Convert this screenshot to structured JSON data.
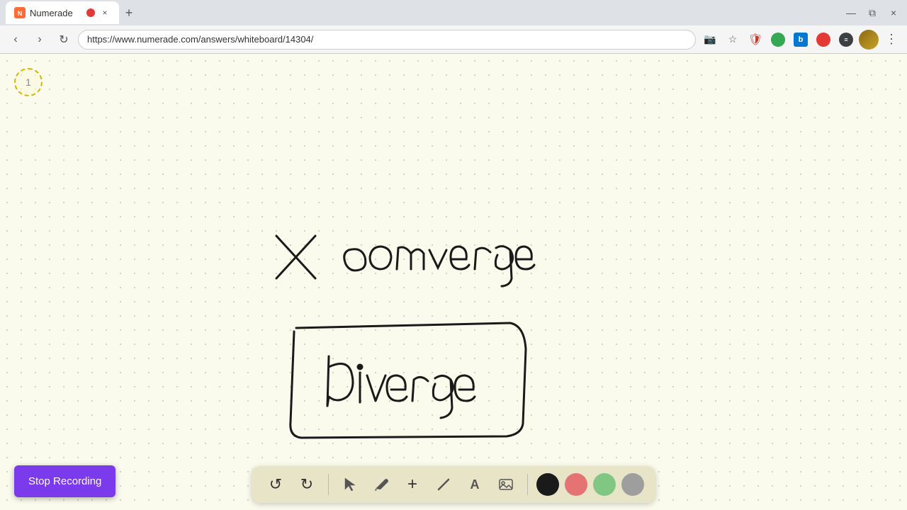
{
  "browser": {
    "tab": {
      "favicon_label": "N",
      "title": "Numerade",
      "recording_dot": true,
      "close_label": "×"
    },
    "new_tab_label": "+",
    "window_controls": {
      "minimize": "—",
      "maximize": "⧉",
      "close": "×"
    },
    "address_bar": {
      "url": "https://www.numerade.com/answers/whiteboard/14304/",
      "back_label": "‹",
      "forward_label": "›",
      "reload_label": "↻"
    }
  },
  "whiteboard": {
    "page_number": "1",
    "drawing": {
      "line1_text": "× converge",
      "line2_text": "diverge"
    }
  },
  "toolbar": {
    "tools": [
      {
        "name": "undo",
        "label": "↺"
      },
      {
        "name": "redo",
        "label": "↻"
      },
      {
        "name": "select",
        "label": "▲"
      },
      {
        "name": "pen",
        "label": "✏"
      },
      {
        "name": "add",
        "label": "+"
      },
      {
        "name": "eraser",
        "label": "╱"
      },
      {
        "name": "text",
        "label": "A"
      },
      {
        "name": "image",
        "label": "🖼"
      }
    ],
    "colors": [
      {
        "name": "black",
        "hex": "#1a1a1a"
      },
      {
        "name": "pink",
        "hex": "#e57373"
      },
      {
        "name": "green",
        "hex": "#81c784"
      },
      {
        "name": "gray",
        "hex": "#9e9e9e"
      }
    ]
  },
  "stop_recording": {
    "label": "Stop Recording"
  }
}
